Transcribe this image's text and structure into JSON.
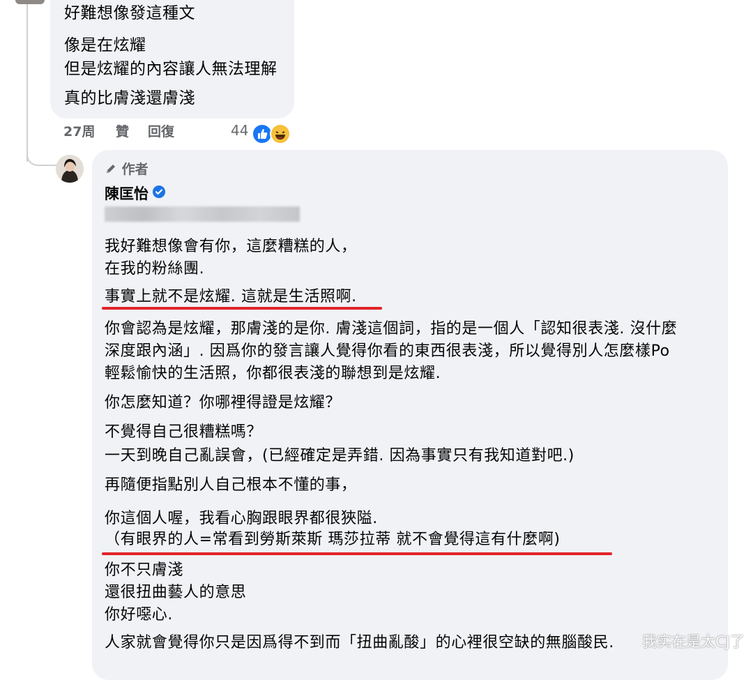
{
  "top_comment": {
    "lines": [
      "好難想像發這種文",
      "像是在炫耀",
      "但是炫耀的內容讓人無法理解",
      "真的比膚淺還膚淺"
    ],
    "time": "27周",
    "like_label": "贊",
    "reply_label": "回復",
    "reaction_count": "44",
    "reaction_icons": [
      "like-reaction-icon",
      "haha-reaction-icon"
    ]
  },
  "reply": {
    "author_badge": "作者",
    "author_badge_icon": "pencil-icon",
    "author_name": "陳匡怡",
    "verified_icon": "verified-badge-icon",
    "paragraphs": [
      "我好難想像會有你，這麼糟糕的人，",
      "在我的粉絲團.",
      "事實上就不是炫耀. 這就是生活照啊.",
      "你會認為是炫耀，那膚淺的是你. 膚淺這個詞，指的是一個人「認知很表淺. 沒什麼",
      "深度跟內涵」. 因爲你的發言讓人覺得你看的東西很表淺，所以覺得別人怎麼樣Po",
      "輕鬆愉快的生活照，你都很表淺的聯想到是炫耀.",
      "你怎麼知道？你哪裡得證是炫耀？",
      "不覺得自己很糟糕嗎？",
      "一天到晚自己亂誤會，(已經確定是弄錯. 因為事實只有我知道對吧.)",
      "再隨便指點別人自己根本不懂的事，",
      "你這個人喔，我看心胸跟眼界都很狹隘.",
      "（有眼界的人=常看到勞斯萊斯 瑪莎拉蒂 就不會覺得這有什麼啊)",
      "你不只膚淺",
      "還很扭曲藝人的意思",
      "你好噁心.",
      "人家就會覺得你只是因爲得不到而「扭曲亂酸」的心裡很空缺的無腦酸民."
    ]
  },
  "watermark": "我实在是太CJ了",
  "colors": {
    "bubble_bg": "#f0f2f5",
    "secondary_text": "#65676b",
    "underline_red": "#e1242a",
    "verified_blue": "#1b74e4",
    "like_blue": "#1877f2",
    "haha_yellow": "#f7c03d"
  }
}
